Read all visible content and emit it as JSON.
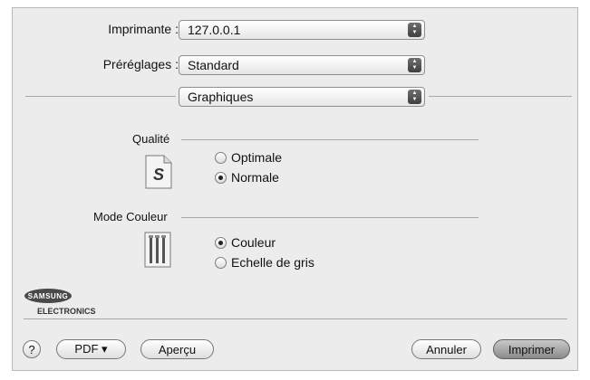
{
  "printer": {
    "label": "Imprimante :",
    "value": "127.0.0.1"
  },
  "presets": {
    "label": "Préréglages :",
    "value": "Standard"
  },
  "panel": {
    "value": "Graphiques"
  },
  "quality": {
    "label": "Qualité",
    "options": [
      {
        "label": "Optimale",
        "selected": false
      },
      {
        "label": "Normale",
        "selected": true
      }
    ],
    "icon": "quality-s-document-icon"
  },
  "color_mode": {
    "label": "Mode Couleur",
    "options": [
      {
        "label": "Couleur",
        "selected": true
      },
      {
        "label": "Echelle de gris",
        "selected": false
      }
    ],
    "icon": "toner-cartridges-icon"
  },
  "logo": {
    "brand": "SAMSUNG",
    "sub": "ELECTRONICS"
  },
  "buttons": {
    "help": "?",
    "pdf": "PDF ▾",
    "preview": "Aperçu",
    "cancel": "Annuler",
    "print": "Imprimer"
  }
}
